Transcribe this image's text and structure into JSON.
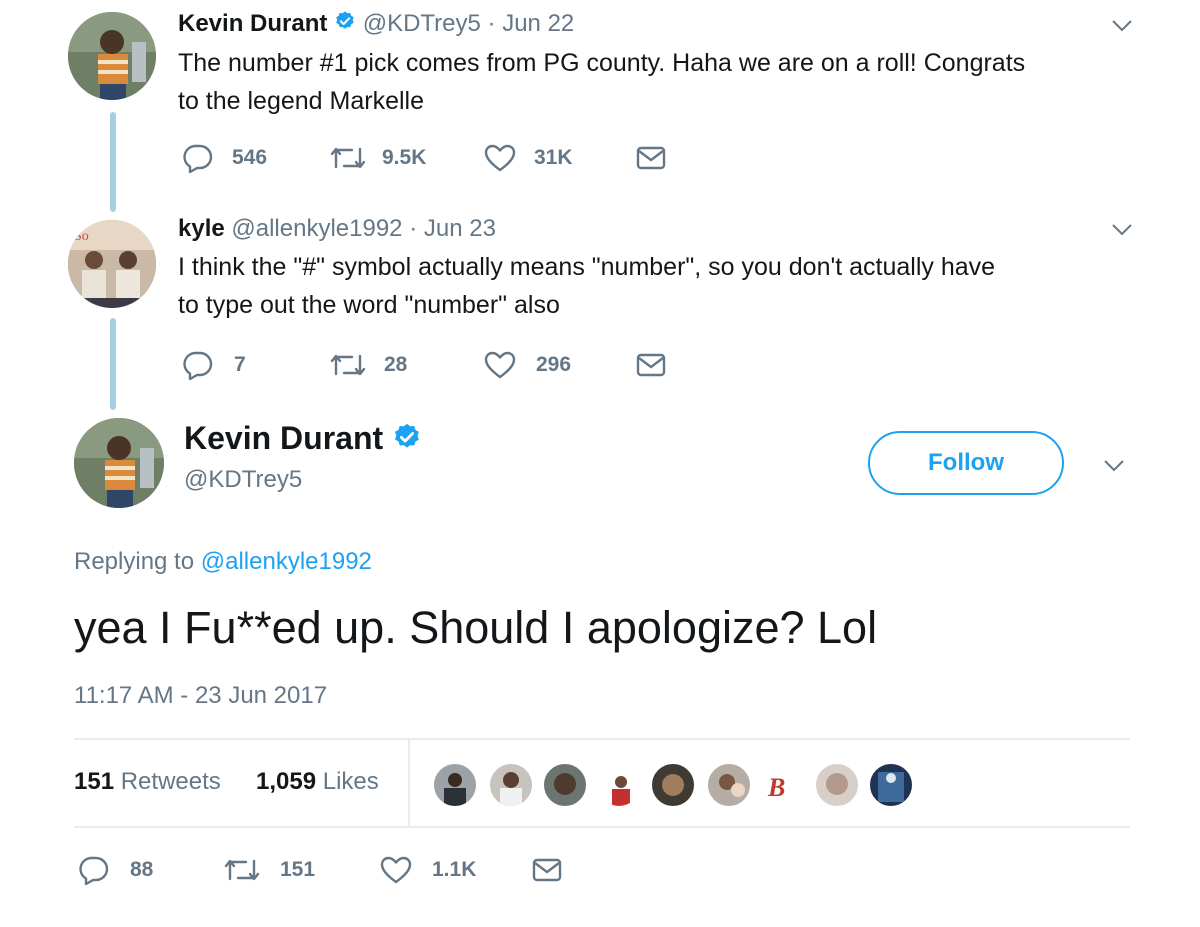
{
  "colors": {
    "accent": "#1da1f2",
    "muted": "#657786",
    "thread": "#a7cfe3"
  },
  "tweet1": {
    "name": "Kevin Durant",
    "handle": "@KDTrey5",
    "date": "· Jun 22",
    "text_line1": "The number #1 pick comes from PG county. Haha we are on a roll! Congrats",
    "text_line2": "to the legend Markelle",
    "replies": "546",
    "retweets": "9.5K",
    "likes": "31K"
  },
  "tweet2": {
    "name": "kyle",
    "handle": "@allenkyle1992",
    "date": "· Jun 23",
    "text_line1": "I think the \"#\" symbol actually means \"number\", so you don't actually have",
    "text_line2": "to type out the word \"number\" also",
    "replies": "7",
    "retweets": "28",
    "likes": "296"
  },
  "main": {
    "name": "Kevin Durant",
    "handle": "@KDTrey5",
    "follow_label": "Follow",
    "replying_prefix": "Replying to",
    "replying_handle": "@allenkyle1992",
    "text": "yea I Fu**ed up. Should I apologize? Lol",
    "timestamp": "11:17 AM - 23 Jun 2017",
    "retweet_count": "151",
    "retweet_label": "Retweets",
    "like_count": "1,059",
    "like_label": "Likes",
    "replies": "88",
    "retweets": "151",
    "likes": "1.1K"
  },
  "icons": [
    "reply-icon",
    "retweet-icon",
    "like-icon",
    "message-icon",
    "verified-icon",
    "chevron-down-icon"
  ]
}
